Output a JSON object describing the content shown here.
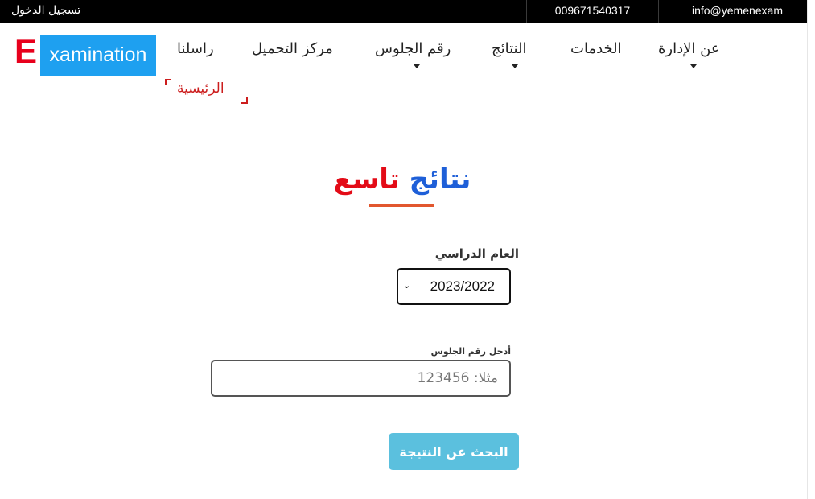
{
  "topbar": {
    "login": "تسجيل الدخول",
    "phone": "009671540317",
    "email": "info@yemenexam"
  },
  "logo": {
    "letter": "E",
    "text": "xamination"
  },
  "nav": {
    "about": "عن الإدارة",
    "services": "الخدمات",
    "results": "النتائج",
    "seat_number": "رقم الجلوس",
    "downloads": "مركز التحميل",
    "contact": "راسلنا",
    "home": "الرئيسية"
  },
  "heading": {
    "word1": "نتائج",
    "word2": "تاسع"
  },
  "form": {
    "year_label": "العام الدراسي",
    "year_value": "2023/2022",
    "seat_label": "أدخل رقم الجلوس",
    "seat_placeholder": "مثلا: 123456",
    "search_button": "البحث عن النتيجة"
  },
  "colors": {
    "accent_blue": "#1ea0f0",
    "logo_red": "#e8001c",
    "heading_blue": "#1e5fd8",
    "heading_red": "#e30b17",
    "button": "#5bc0de"
  }
}
